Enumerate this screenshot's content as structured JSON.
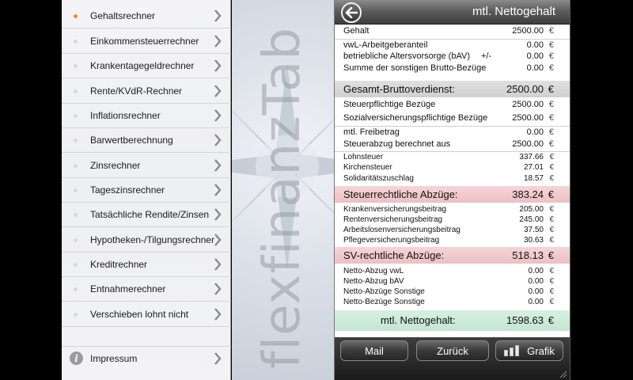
{
  "menu": {
    "items": [
      {
        "label": "Gehaltsrechner",
        "active": true
      },
      {
        "label": "Einkommensteuerrechner",
        "active": false
      },
      {
        "label": "Krankentagegeldrechner",
        "active": false
      },
      {
        "label": "Rente/KVdR-Rechner",
        "active": false
      },
      {
        "label": "Inflationsrechner",
        "active": false
      },
      {
        "label": "Barwertberechnung",
        "active": false
      },
      {
        "label": "Zinsrechner",
        "active": false
      },
      {
        "label": "Tageszinsrechner",
        "active": false
      },
      {
        "label": "Tatsächliche Rendite/Zinsen",
        "active": false
      },
      {
        "label": "Hypotheken-/Tilgungsrechner",
        "active": false
      },
      {
        "label": "Kreditrechner",
        "active": false
      },
      {
        "label": "Entnahmerechner",
        "active": false
      },
      {
        "label": "Verschieben lohnt nicht",
        "active": false
      }
    ],
    "impressum_label": "Impressum",
    "info_glyph": "i"
  },
  "brand": {
    "text": "flexfinanzTab"
  },
  "panel": {
    "title": "mtl. Nettogehalt",
    "currency": "€",
    "gehalt": {
      "label": "Gehalt",
      "value": "2500.00"
    },
    "vwl": {
      "label": "vwL-Arbeitgeberanteil",
      "value": "0.00"
    },
    "bav": {
      "label": "betriebliche Altersvorsorge (bAV)",
      "extra": "+/-",
      "value": "0.00"
    },
    "sonstige": {
      "label": "Summe der sonstigen Brutto-Bezüge",
      "value": "0.00"
    },
    "brutto_total": {
      "label": "Gesamt-Bruttoverdienst:",
      "value": "2500.00"
    },
    "steuerpflichtig": {
      "label": "Steuerpflichtige Bezüge",
      "value": "2500.00"
    },
    "sv_pflichtig": {
      "label": "Sozialversicherungspflichtige Bezüge",
      "value": "2500.00"
    },
    "freibetrag": {
      "label": "mtl. Freibetrag",
      "value": "0.00"
    },
    "steuerabzug": {
      "label": "Steuerabzug berechnet aus",
      "value": "2500.00"
    },
    "lohnsteuer": {
      "label": "Lohnsteuer",
      "value": "337.66"
    },
    "kirchensteuer": {
      "label": "Kirchensteuer",
      "value": "27.01"
    },
    "soli": {
      "label": "Solidaritätszuschlag",
      "value": "18.57"
    },
    "steuer_total": {
      "label": "Steuerrechtliche Abzüge:",
      "value": "383.24"
    },
    "kv": {
      "label": "Krankenversicherungsbeitrag",
      "value": "205.00"
    },
    "rv": {
      "label": "Rentenversicherungsbeitrag",
      "value": "245.00"
    },
    "av": {
      "label": "Arbeitslosenversicherungsbeitrag",
      "value": "37.50"
    },
    "pv": {
      "label": "Pflegeversicherungsbeitrag",
      "value": "30.63"
    },
    "sv_total": {
      "label": "SV-rechtliche Abzüge:",
      "value": "518.13"
    },
    "netto_vwl": {
      "label": "Netto-Abzug vwL",
      "value": "0.00"
    },
    "netto_bav": {
      "label": "Netto-Abzug bAV",
      "value": "0.00"
    },
    "netto_sonstige": {
      "label": "Netto-Abzüge Sonstige",
      "value": "0.00"
    },
    "netto_bezuege": {
      "label": "Netto-Bezüge Sonstige",
      "value": "0.00"
    },
    "netto_total": {
      "label": "mtl. Nettogehalt:",
      "value": "1598.63"
    }
  },
  "toolbar": {
    "mail_label": "Mail",
    "back_label": "Zurück",
    "graph_label": "Grafik"
  },
  "colors": {
    "accent_bullet": "#f08a24",
    "steuer_bg": "#f6d5d8",
    "netto_bg": "#d7efe1"
  }
}
